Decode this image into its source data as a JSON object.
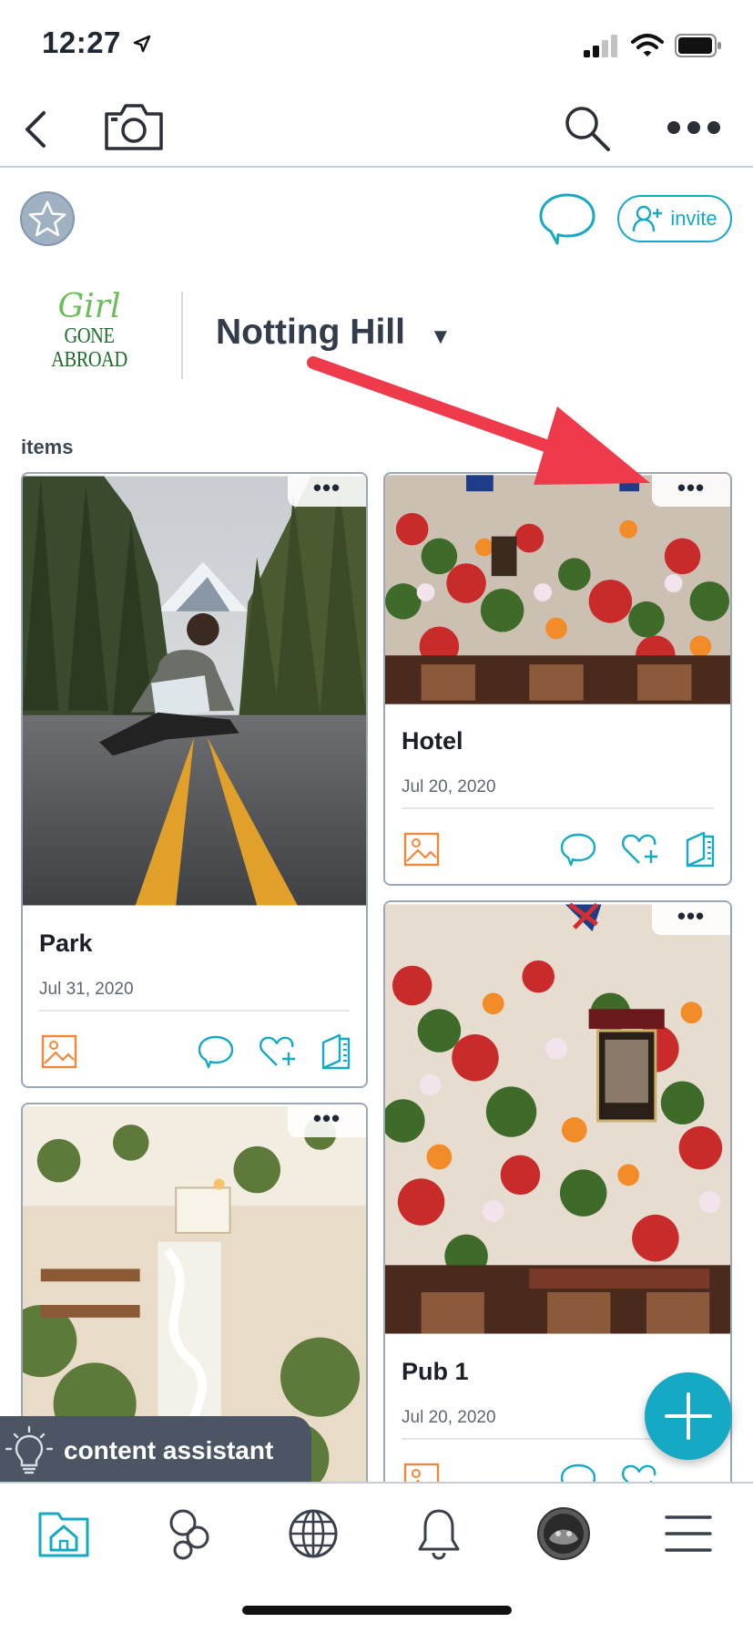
{
  "status_bar": {
    "time": "12:27"
  },
  "header": {
    "back_icon": "chevron-left-icon",
    "camera_icon": "camera-icon",
    "search_icon": "search-icon",
    "more_icon": "more-horizontal-icon"
  },
  "toolbar": {
    "star_icon": "star-icon",
    "chat_icon": "chat-icon",
    "invite_label": "invite"
  },
  "project": {
    "logo_line1": "Girl",
    "logo_line2": "GONE",
    "logo_line3": "ABROAD",
    "title": "Notting Hill",
    "caret": "▼"
  },
  "section_label": "items",
  "cards": [
    {
      "title": "Park",
      "date": "Jul 31, 2020",
      "menu": "•••"
    },
    {
      "title": "Hotel",
      "date": "Jul 20, 2020",
      "menu": "•••"
    },
    {
      "title": "",
      "date": "",
      "menu": "•••"
    },
    {
      "title": "Pub 1",
      "date": "Jul 20, 2020",
      "menu": "•••"
    }
  ],
  "assistant": {
    "label": "content assistant"
  },
  "tabs": [
    "home-icon",
    "circles-icon",
    "globe-icon",
    "bell-icon",
    "avatar",
    "menu-icon"
  ],
  "colors": {
    "accent": "#15a9c4",
    "orange": "#f0883a",
    "annotation": "#ef3a4c"
  }
}
